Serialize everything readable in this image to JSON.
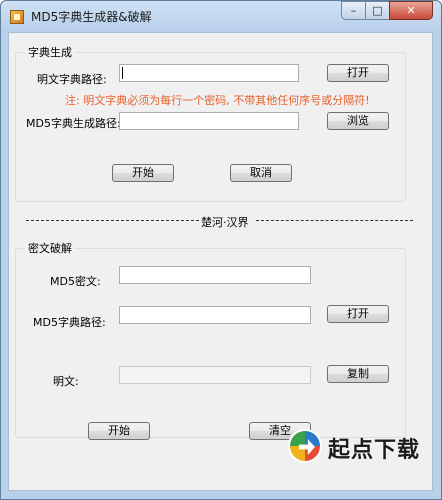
{
  "window": {
    "title": "MD5字典生成器&破解",
    "controls": {
      "minimize": "–",
      "maximize": "□",
      "close": "✕"
    }
  },
  "dict_section": {
    "group_title": "字典生成",
    "plain_dict_path_label": "明文字典路径:",
    "plain_dict_path_value": "",
    "open_button": "打开",
    "note": "注: 明文字典必须为每行一个密码, 不带其他任何序号或分隔符!",
    "md5_dict_output_label": "MD5字典生成路径:",
    "md5_dict_output_value": "",
    "browse_button": "浏览",
    "start_button": "开始",
    "cancel_button": "取消"
  },
  "separator": {
    "text": "楚河·汉界"
  },
  "crack_section": {
    "group_title": "密文破解",
    "md5_cipher_label": "MD5密文:",
    "md5_cipher_value": "",
    "md5_dict_path_label": "MD5字典路径:",
    "md5_dict_path_value": "",
    "open_button": "打开",
    "plaintext_label": "明文:",
    "plaintext_value": "",
    "copy_button": "复制",
    "start_button": "开始",
    "clear_button": "清空"
  },
  "watermark": {
    "text": "起点下载",
    "icon": "arrow-logo-icon"
  }
}
